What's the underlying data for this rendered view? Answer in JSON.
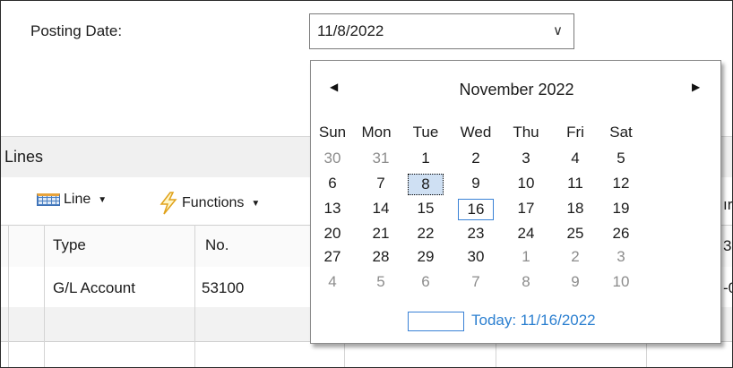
{
  "form": {
    "posting_date_label": "Posting Date:",
    "posting_date_value": "11/8/2022"
  },
  "lines": {
    "title": "Lines",
    "toolbar": {
      "line_label": "Line",
      "functions_label": "Functions"
    },
    "columns": [
      "Type",
      "No."
    ],
    "rows": [
      [
        "G/L Account",
        "53100"
      ]
    ],
    "partial_right_text": [
      "ır",
      "3S",
      "-0"
    ]
  },
  "calendar": {
    "month_title": "November 2022",
    "prev_icon": "triangle-left-icon",
    "next_icon": "triangle-right-icon",
    "weekdays": [
      "Sun",
      "Mon",
      "Tue",
      "Wed",
      "Thu",
      "Fri",
      "Sat"
    ],
    "weeks": [
      [
        "30",
        "31",
        "1",
        "2",
        "3",
        "4",
        "5"
      ],
      [
        "6",
        "7",
        "8",
        "9",
        "10",
        "11",
        "12"
      ],
      [
        "13",
        "14",
        "15",
        "16",
        "17",
        "18",
        "19"
      ],
      [
        "20",
        "21",
        "22",
        "23",
        "24",
        "25",
        "26"
      ],
      [
        "27",
        "28",
        "29",
        "30",
        "1",
        "2",
        "3"
      ],
      [
        "4",
        "5",
        "6",
        "7",
        "8",
        "9",
        "10"
      ]
    ],
    "selected_day": "8",
    "today_day": "16",
    "today_text": "Today: 11/16/2022",
    "accent_color": "#3a82d6"
  }
}
